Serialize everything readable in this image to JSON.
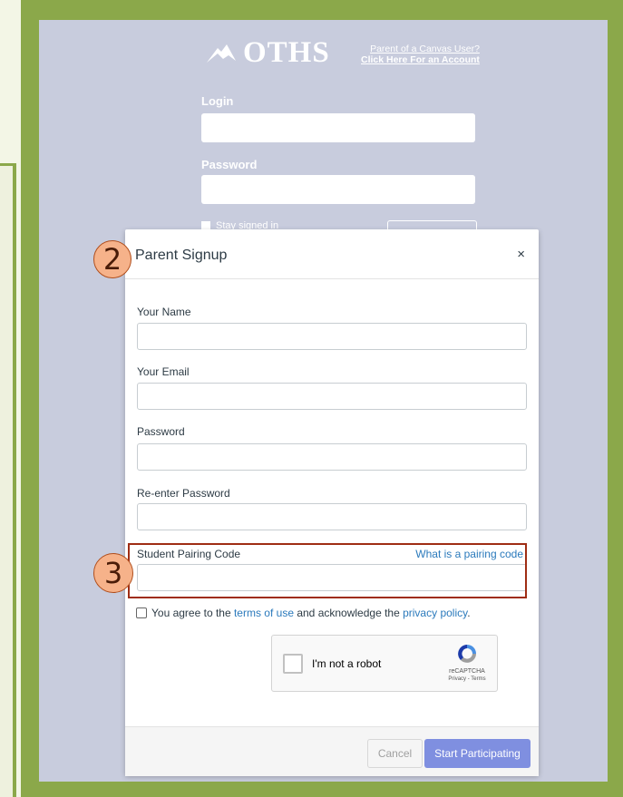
{
  "colors": {
    "frame_green": "#8ba84a",
    "canvas_bg": "#c8ccdd",
    "primary_button": "#7f8fe0",
    "link_blue": "#2b7abc",
    "annotation_fill": "#f6b28a",
    "annotation_border": "#9f2d14"
  },
  "login_page": {
    "logo_text": "OTHS",
    "logo_icon": "mountain-logo-icon",
    "parent_link_line1": "Parent of a Canvas User?",
    "parent_link_line2": "Click Here For an Account",
    "login_label": "Login",
    "password_label": "Password",
    "stay_signed_in": "Stay signed in"
  },
  "modal": {
    "title": "Parent Signup",
    "close_icon": "close-icon",
    "close_glyph": "×",
    "fields": [
      {
        "label": "Your Name",
        "value": ""
      },
      {
        "label": "Your Email",
        "value": ""
      },
      {
        "label": "Password",
        "value": ""
      },
      {
        "label": "Re-enter Password",
        "value": ""
      },
      {
        "label": "Student Pairing Code",
        "value": ""
      }
    ],
    "pairing_help_link": "What is a pairing code",
    "agree_prefix": "You agree to the ",
    "agree_terms": "terms of use",
    "agree_middle": " and acknowledge the ",
    "agree_privacy": "privacy policy",
    "agree_suffix": ".",
    "recaptcha": {
      "label": "I'm not a robot",
      "brand": "reCAPTCHA",
      "terms": "Privacy - Terms"
    },
    "footer": {
      "cancel_label": "Cancel",
      "submit_label": "Start Participating"
    }
  },
  "annotations": {
    "callout_2": "2",
    "callout_3": "3"
  }
}
